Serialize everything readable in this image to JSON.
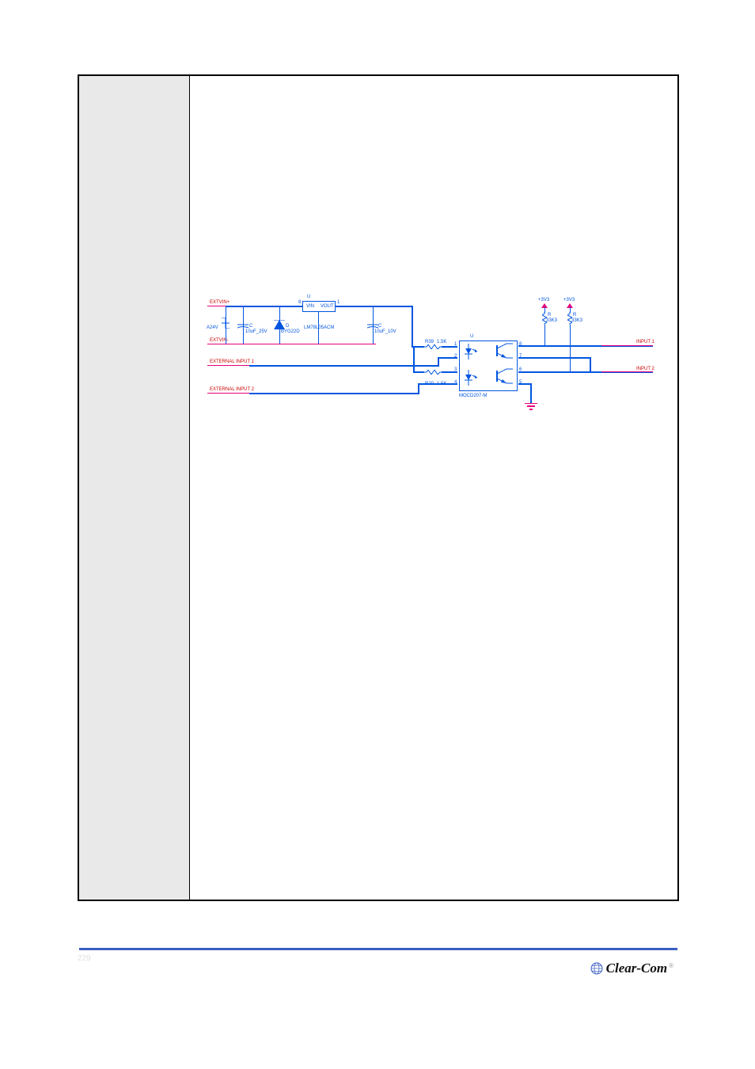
{
  "signals": {
    "extvin_pos": "EXTVIN+",
    "extvin_neg": "EXTVIN-",
    "ext_input_1": "EXTERNAL INPUT 1",
    "ext_input_2": "EXTERNAL INPUT 2",
    "input_1": "INPUT 1",
    "input_2": "INPUT 2",
    "rail_3v3_a": "+3V3",
    "rail_3v3_b": "+3V3"
  },
  "components": {
    "u_left": {
      "refdes": "U",
      "part": "LM78L05ACM",
      "pin_vin": "VIN",
      "pin_vout": "VOUT",
      "pin_8": "8",
      "pin_1": "1"
    },
    "u_right": {
      "refdes": "U",
      "part": "MOCD207-M"
    },
    "d_zener": {
      "refdes": "D",
      "part": "A24V"
    },
    "c_in": {
      "refdes": "C",
      "value": "10uF_25V"
    },
    "c_out": {
      "refdes": "C",
      "value": "10uF_10V"
    },
    "d_tvs": {
      "refdes": "D",
      "part": "BYG22D"
    },
    "r39": {
      "refdes": "R39",
      "value": "1.5K"
    },
    "r20": {
      "refdes": "R20",
      "value": "1.5K"
    },
    "r_pullup_a": {
      "refdes": "R",
      "value": "33K3"
    },
    "r_pullup_b": {
      "refdes": "R",
      "value": "33K3"
    }
  },
  "pins": {
    "opto_1": "1",
    "opto_2": "2",
    "opto_3": "3",
    "opto_4": "4",
    "opto_5": "5",
    "opto_6": "6",
    "opto_7": "7",
    "opto_8": "8"
  },
  "footer": {
    "page_number": "229",
    "brand": "Clear-Com"
  }
}
